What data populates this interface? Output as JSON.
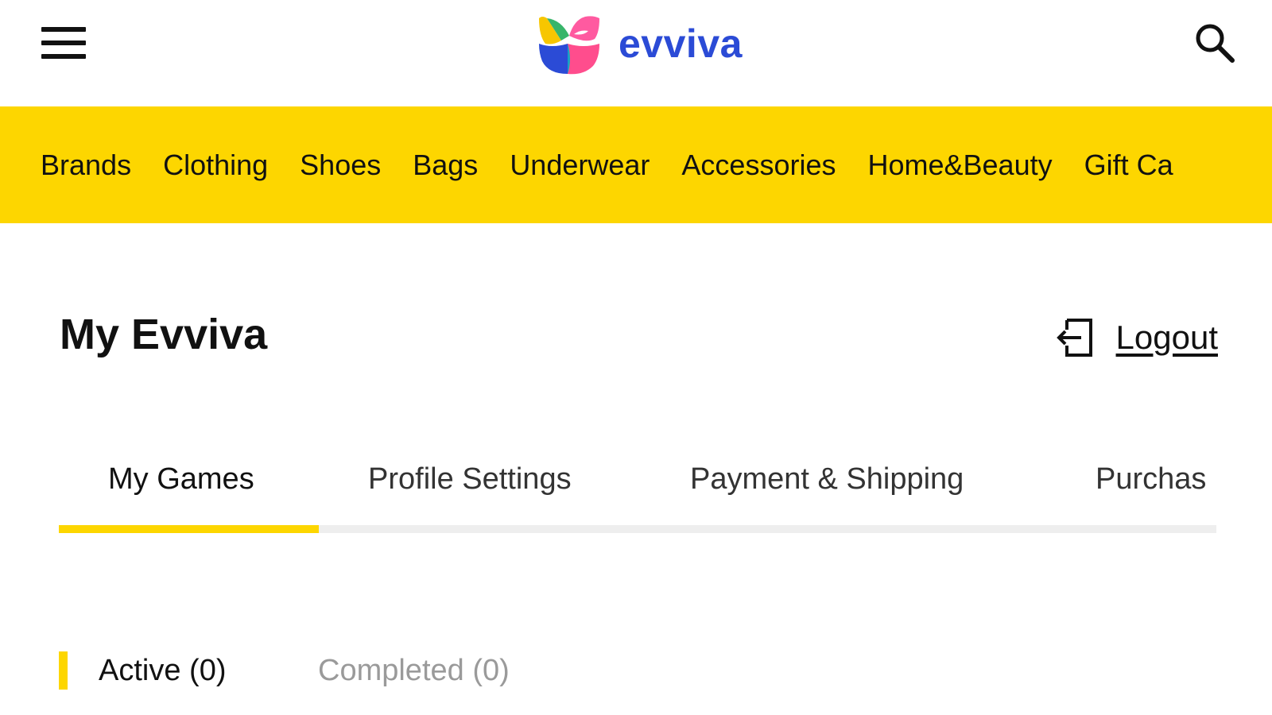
{
  "header": {
    "brand_name": "evviva",
    "menu_icon": "hamburger-menu-icon",
    "search_icon": "search-icon",
    "brand_color": "#2b4bd6"
  },
  "nav": {
    "background_color": "#fdd600",
    "items": [
      {
        "label": "Brands"
      },
      {
        "label": "Clothing"
      },
      {
        "label": "Shoes"
      },
      {
        "label": "Bags"
      },
      {
        "label": "Underwear"
      },
      {
        "label": "Accessories"
      },
      {
        "label": "Home&Beauty"
      },
      {
        "label": "Gift Ca"
      }
    ]
  },
  "account": {
    "title": "My Evviva",
    "logout_label": "Logout",
    "logout_icon": "logout-icon"
  },
  "tabs": [
    {
      "label": "My Games",
      "active": true
    },
    {
      "label": "Profile Settings",
      "active": false
    },
    {
      "label": "Payment & Shipping",
      "active": false
    },
    {
      "label": "Purchas",
      "active": false
    }
  ],
  "subtabs": [
    {
      "label": "Active (0)",
      "active": true
    },
    {
      "label": "Completed (0)",
      "active": false
    }
  ],
  "accent_color": "#fdd600"
}
